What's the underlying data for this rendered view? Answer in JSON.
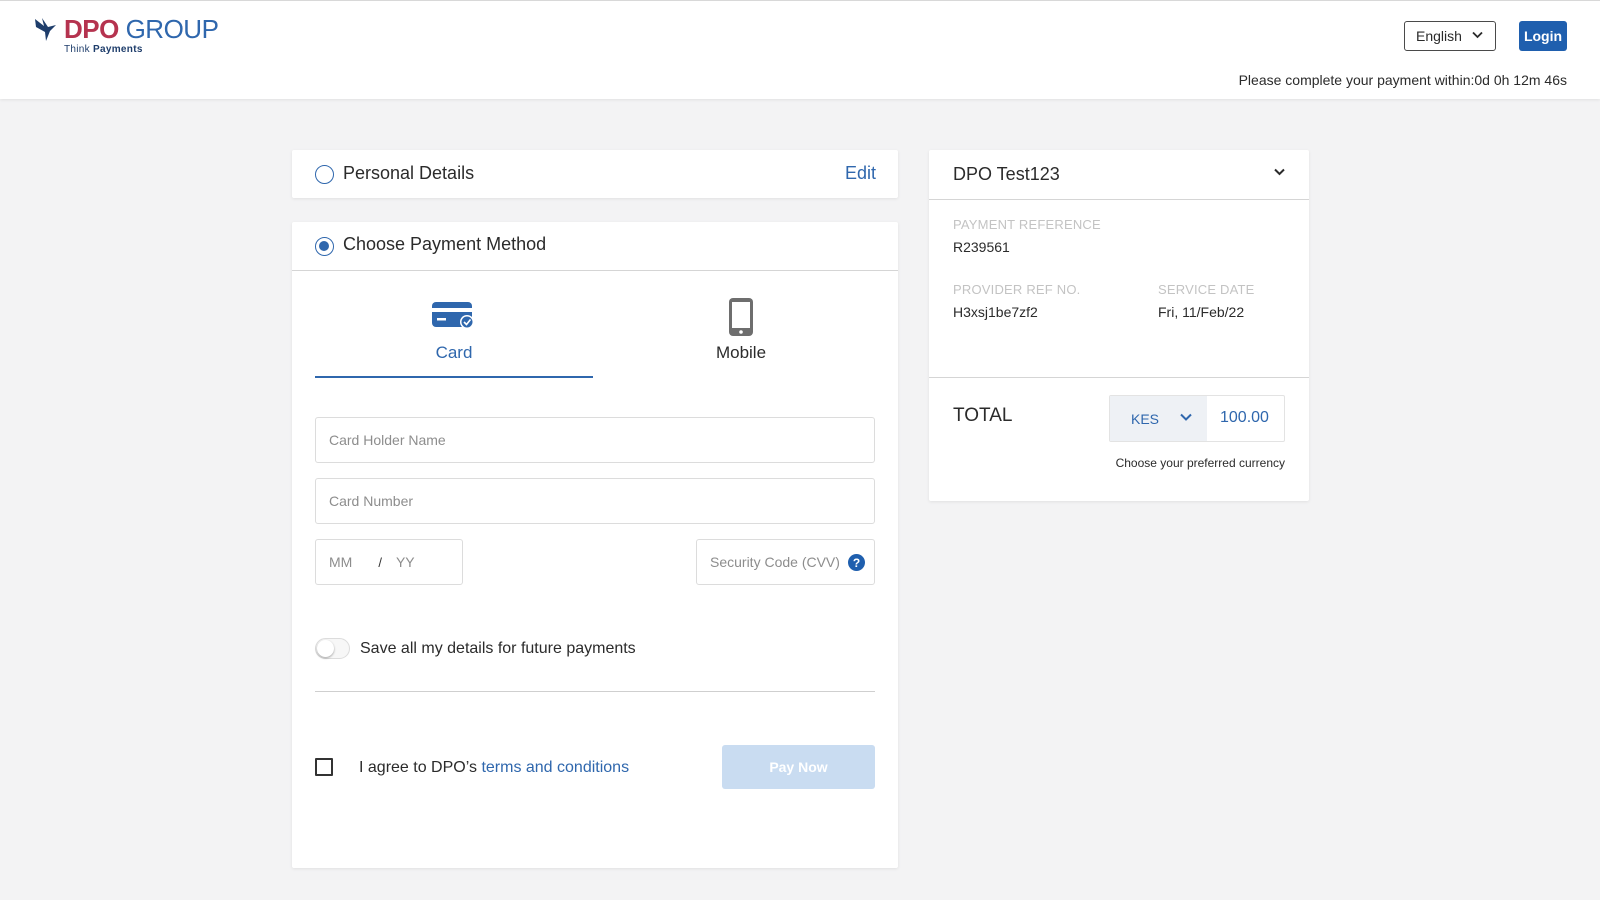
{
  "header": {
    "logo": {
      "brand_first": "DPO",
      "brand_second": " GROUP",
      "tagline_first": "Think ",
      "tagline_second": "Payments"
    },
    "language": "English",
    "login_label": "Login",
    "timer_text": "Please complete your payment within:0d 0h 12m 46s"
  },
  "personal_details": {
    "title": "Personal Details",
    "edit_label": "Edit"
  },
  "payment_method": {
    "title": "Choose Payment Method",
    "tabs": [
      {
        "label": "Card",
        "icon": "credit-card-icon",
        "selected": true
      },
      {
        "label": "Mobile",
        "icon": "mobile-phone-icon",
        "selected": false
      }
    ],
    "card_holder_placeholder": "Card Holder Name",
    "card_number_placeholder": "Card Number",
    "expiry_month_placeholder": "MM",
    "expiry_separator": "/",
    "expiry_year_placeholder": "YY",
    "cvv_placeholder": "Security Code (CVV)",
    "cvv_help": "?",
    "save_details_label": "Save all my details for future payments",
    "save_details_enabled": false,
    "agree_prefix": "I agree to DPO’s ",
    "terms_link": "terms and conditions",
    "agree_checked": false,
    "pay_now_label": "Pay Now"
  },
  "summary": {
    "merchant": "DPO Test123",
    "payment_reference_label": "PAYMENT REFERENCE",
    "payment_reference": "R239561",
    "provider_ref_label": "PROVIDER REF NO.",
    "provider_ref": "H3xsj1be7zf2",
    "service_date_label": "SERVICE DATE",
    "service_date": "Fri, 11/Feb/22",
    "total_label": "TOTAL",
    "currency": "KES",
    "amount": "100.00",
    "currency_hint": "Choose your preferred currency"
  },
  "colors": {
    "brand_red": "#b5334f",
    "brand_blue": "#2f67ad",
    "button_blue": "#1f5fae",
    "disabled_button": "#c9dcf1",
    "page_background": "#f3f3f4"
  }
}
